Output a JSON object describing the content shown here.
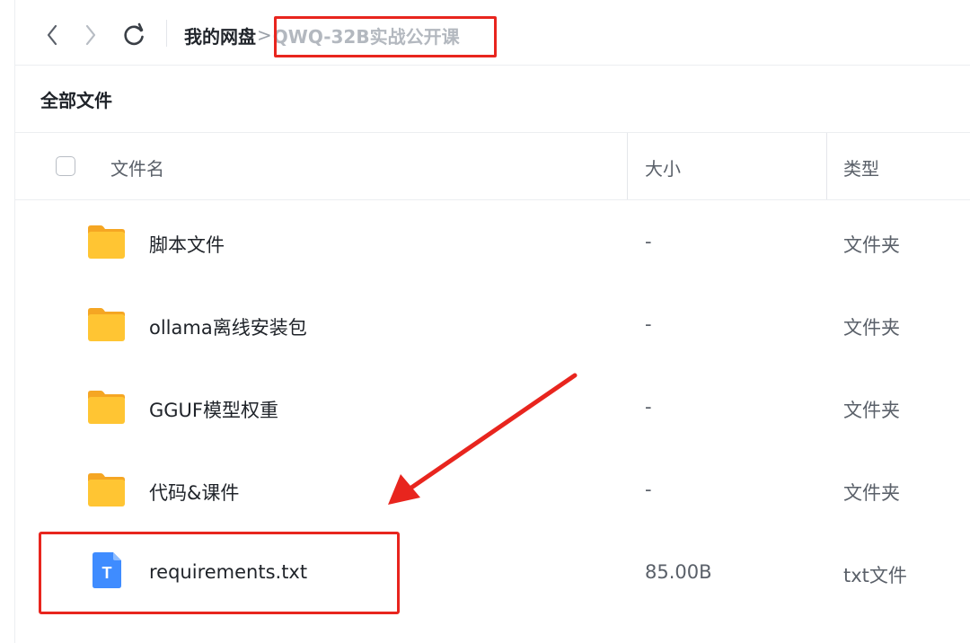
{
  "toolbar": {
    "back_icon": "chevron-left-icon",
    "forward_icon": "chevron-right-icon",
    "refresh_icon": "refresh-icon"
  },
  "breadcrumb": {
    "root": "我的网盘",
    "separator": ">",
    "current": "QWQ-32B实战公开课"
  },
  "section": {
    "title": "全部文件"
  },
  "table": {
    "columns": {
      "name": "文件名",
      "size": "大小",
      "type": "类型"
    },
    "rows": [
      {
        "name": "脚本文件",
        "size": "-",
        "type": "文件夹",
        "icon": "folder-icon"
      },
      {
        "name": "ollama离线安装包",
        "size": "-",
        "type": "文件夹",
        "icon": "folder-icon"
      },
      {
        "name": "GGUF模型权重",
        "size": "-",
        "type": "文件夹",
        "icon": "folder-icon"
      },
      {
        "name": "代码&课件",
        "size": "-",
        "type": "文件夹",
        "icon": "folder-icon"
      },
      {
        "name": "requirements.txt",
        "size": "85.00B",
        "type": "txt文件",
        "icon": "text-file-icon"
      }
    ]
  },
  "file_icon_letter": "T",
  "colors": {
    "annotation": "#e8251e",
    "folder": "#ffc533",
    "text_file": "#3f8cff"
  }
}
